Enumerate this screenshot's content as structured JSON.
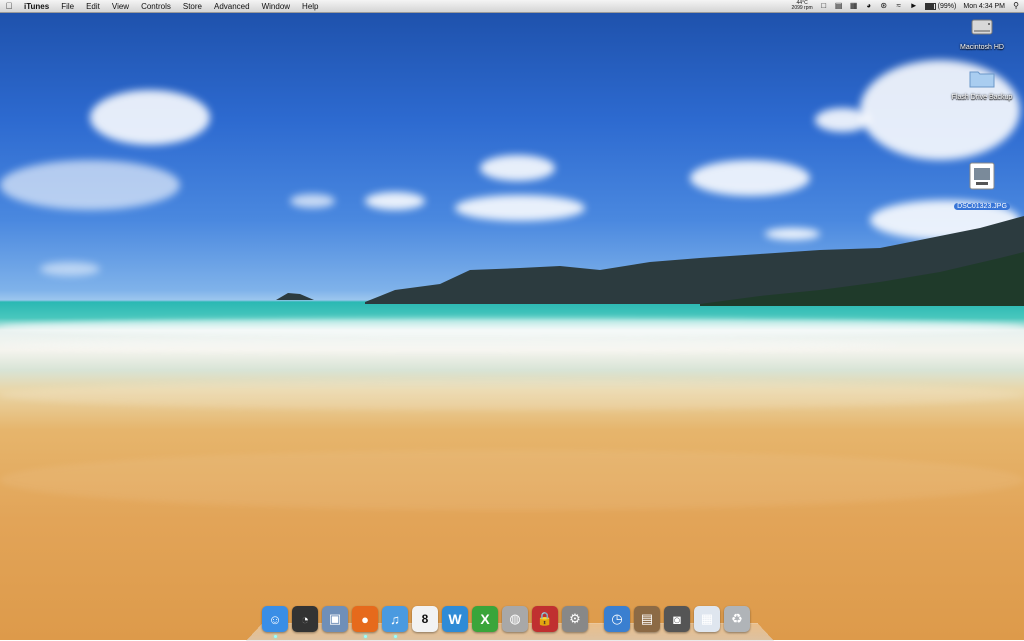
{
  "menubar": {
    "apple_icon": "apple-icon",
    "items": [
      "iTunes",
      "File",
      "Edit",
      "View",
      "Controls",
      "Store",
      "Advanced",
      "Window",
      "Help"
    ],
    "status": {
      "temp_line1": "44°C",
      "temp_line2": "2099 rpm",
      "battery": "(99%)",
      "clock": "Mon 4:34 PM",
      "search_icon": "spotlight-icon"
    }
  },
  "desktop_icons": [
    {
      "label": "Macintosh HD",
      "icon": "hard-drive-icon"
    },
    {
      "label": "Flash Drive Backup",
      "icon": "folder-icon"
    },
    {
      "label": "DSC01323.JPG",
      "icon": "jpeg-file-icon"
    }
  ],
  "dock": {
    "items": [
      {
        "name": "finder",
        "icon": "finder-icon",
        "color": "#3a8ee6",
        "running": true
      },
      {
        "name": "dashboard",
        "icon": "dashboard-icon",
        "color": "#333333",
        "running": false
      },
      {
        "name": "preview",
        "icon": "preview-icon",
        "color": "#6f8fb8",
        "running": false
      },
      {
        "name": "firefox",
        "icon": "firefox-icon",
        "color": "#e66a1c",
        "running": true
      },
      {
        "name": "itunes",
        "icon": "itunes-icon",
        "color": "#4a9ae0",
        "running": true
      },
      {
        "name": "ical",
        "icon": "calendar-icon",
        "color": "#f2f2f2",
        "running": false,
        "text": "8"
      },
      {
        "name": "word",
        "icon": "word-icon",
        "color": "#2f8bd6",
        "running": false,
        "text": "W"
      },
      {
        "name": "excel",
        "icon": "excel-icon",
        "color": "#3aa53a",
        "running": false,
        "text": "X"
      },
      {
        "name": "disk-utility",
        "icon": "disk-utility-icon",
        "color": "#a8a8a8",
        "running": false
      },
      {
        "name": "keychain",
        "icon": "lock-icon",
        "color": "#c03030",
        "running": false
      },
      {
        "name": "system-preferences",
        "icon": "gear-icon",
        "color": "#888888",
        "running": false
      },
      {
        "name": "time-machine",
        "icon": "clock-icon",
        "color": "#3a7fd0",
        "running": false
      },
      {
        "name": "iphoto",
        "icon": "photo-icon",
        "color": "#8c6a45",
        "running": false
      },
      {
        "name": "photo-booth",
        "icon": "camera-icon",
        "color": "#555555",
        "running": false
      },
      {
        "name": "documents-stack",
        "icon": "stack-icon",
        "color": "#dfe6ef",
        "running": false
      },
      {
        "name": "trash",
        "icon": "trash-icon",
        "color": "#b0b4b8",
        "running": false
      }
    ]
  }
}
